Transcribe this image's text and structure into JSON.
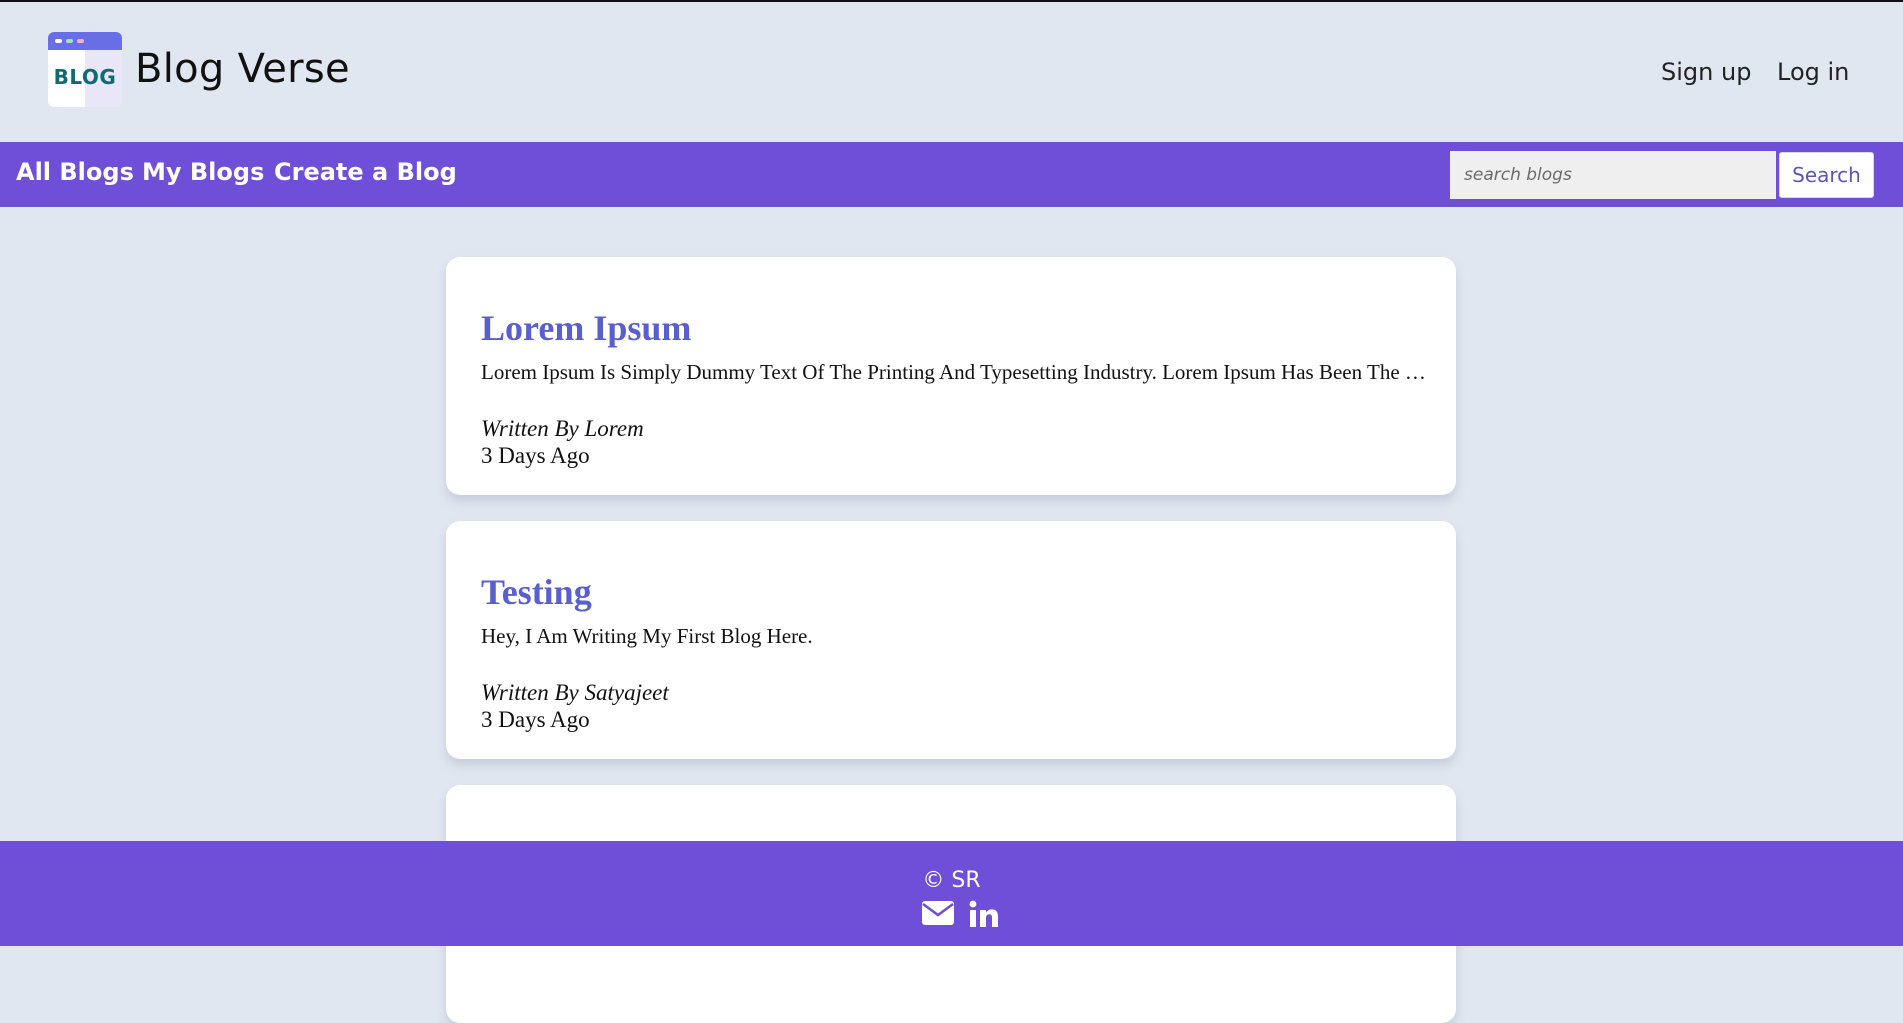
{
  "header": {
    "logo_text": "BLOG",
    "brand": "Blog Verse",
    "signup": "Sign up",
    "login": "Log in"
  },
  "nav": {
    "links": [
      "All Blogs",
      "My Blogs",
      "Create a Blog"
    ],
    "search_placeholder": "search blogs",
    "search_button": "Search"
  },
  "posts": [
    {
      "title": "Lorem Ipsum",
      "excerpt": "Lorem Ipsum Is Simply Dummy Text Of The Printing And Typesetting Industry. Lorem Ipsum Has Been The Industry's Standard",
      "author": "Written By Lorem",
      "date": "3 Days Ago"
    },
    {
      "title": "Testing",
      "excerpt": "Hey, I Am Writing My First Blog Here.",
      "author": "Written By Satyajeet",
      "date": "3 Days Ago"
    }
  ],
  "footer": {
    "copyright": "© SR",
    "icons": [
      "envelope-icon",
      "linkedin-icon"
    ]
  },
  "colors": {
    "background": "#e1e7f0",
    "accent": "#6f4fd8",
    "title": "#5a5fcf",
    "logo_bar": "#6a6ee6"
  }
}
